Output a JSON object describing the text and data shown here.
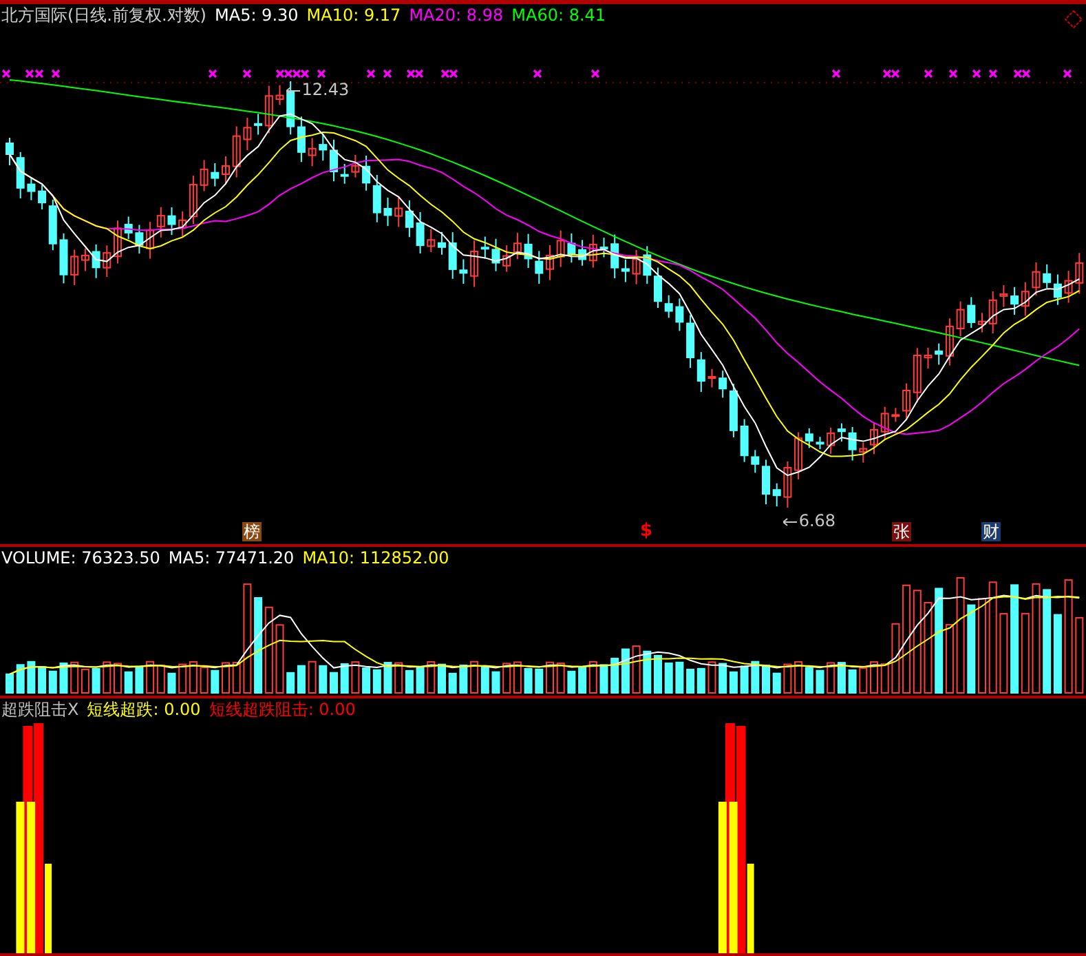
{
  "chart_header": {
    "title": "北方国际(日线.前复权.对数)",
    "ma_legend": [
      {
        "label": "MA5: 9.30",
        "color": "#ffffff"
      },
      {
        "label": "MA10: 9.17",
        "color": "#ffff00"
      },
      {
        "label": "MA20: 8.98",
        "color": "#ff00ff"
      },
      {
        "label": "MA60: 8.41",
        "color": "#00ff00"
      }
    ]
  },
  "price_panel": {
    "high_label": "12.43",
    "low_label": "6.68",
    "event_markers": [
      {
        "kind": "badge",
        "label": "榜",
        "color": "#8b4a14"
      },
      {
        "kind": "symbol",
        "label": "$",
        "color": "#ff0000"
      },
      {
        "kind": "badge",
        "label": "张",
        "color": "#7a1010"
      },
      {
        "kind": "badge",
        "label": "财",
        "color": "#1e3a6e"
      }
    ]
  },
  "volume_panel": {
    "legend": [
      {
        "label": "VOLUME: 76323.50",
        "color": "#ffffff"
      },
      {
        "label": "MA5: 77471.20",
        "color": "#ffffff"
      },
      {
        "label": "MA10: 112852.00",
        "color": "#ffff00"
      }
    ]
  },
  "indicator_panel": {
    "legend": [
      {
        "label": "超跌阻击X",
        "color": "#c0c0c0"
      },
      {
        "label": "短线超跌: 0.00",
        "color": "#ffff00"
      },
      {
        "label": "短线超跌阻击: 0.00",
        "color": "#ff0000"
      }
    ]
  }
}
